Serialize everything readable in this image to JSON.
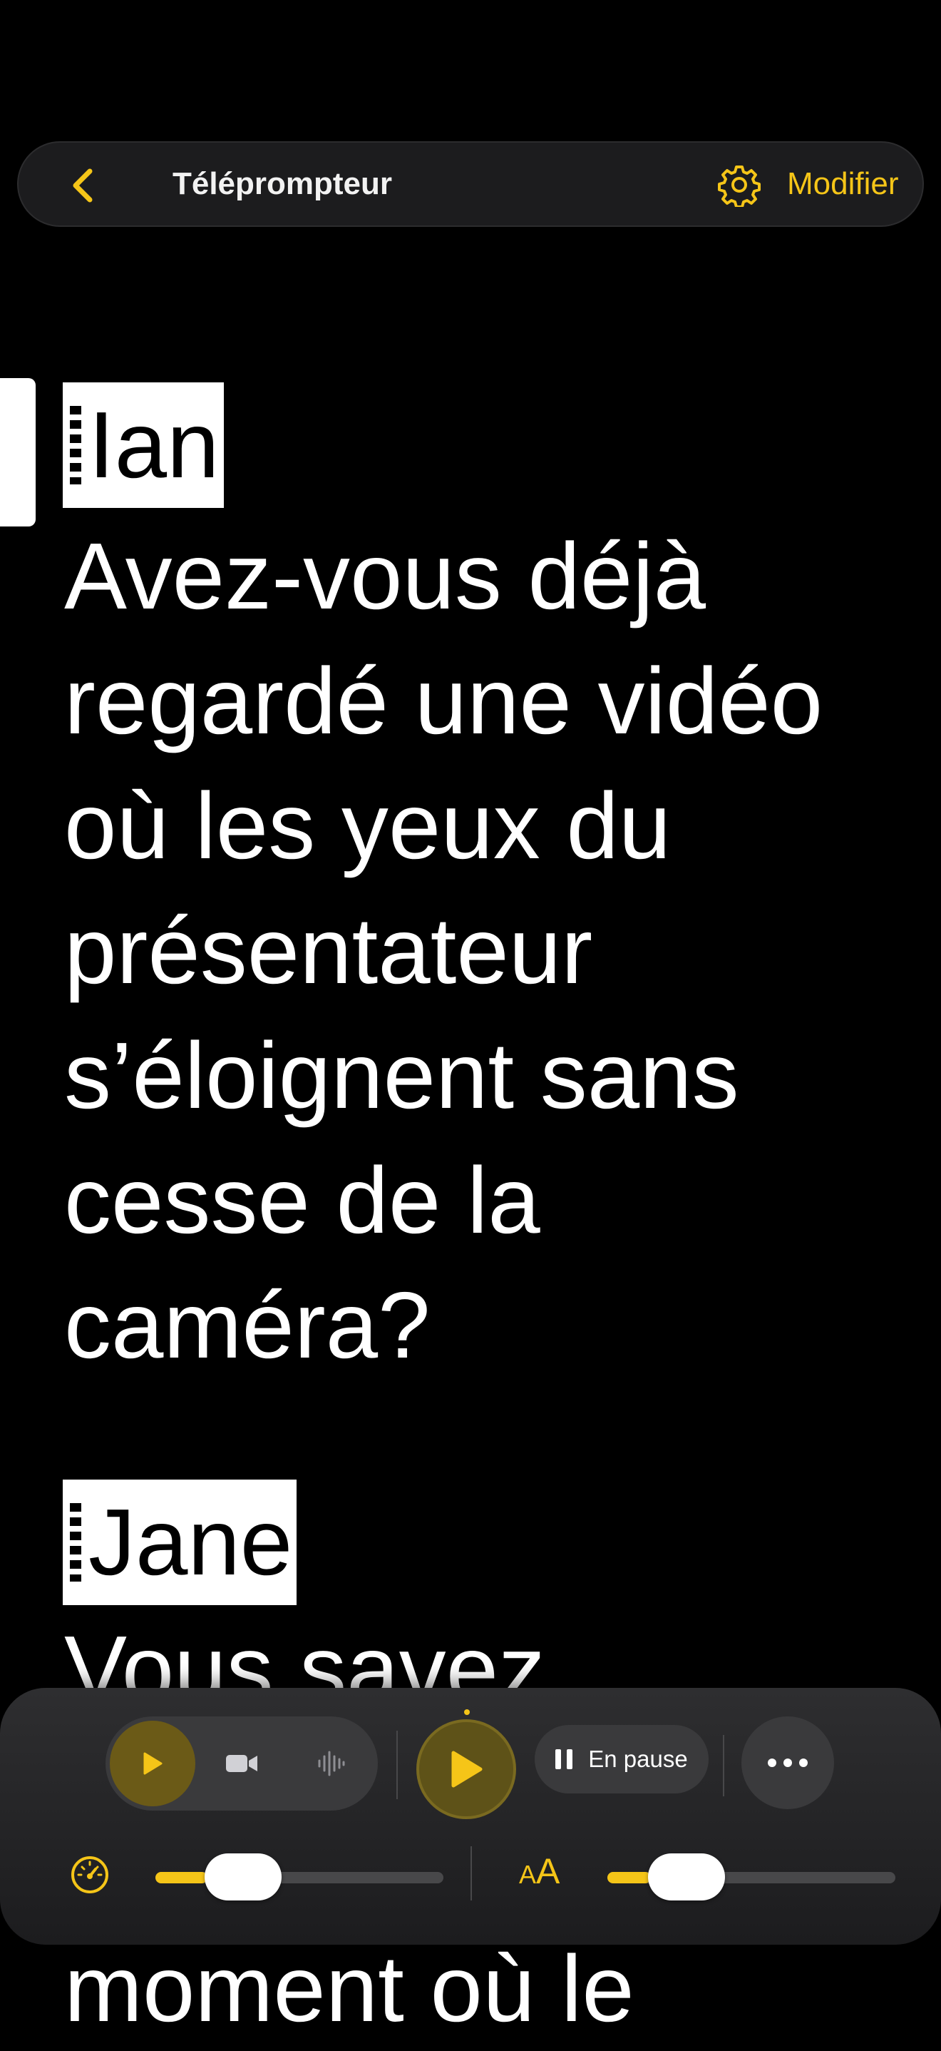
{
  "nav": {
    "back_icon": "chevron-left-icon",
    "title": "Téléprompteur",
    "settings_icon": "gear-icon",
    "edit_label": "Modifier"
  },
  "script": [
    {
      "speaker": "Ian",
      "lines": [
        "Avez-vous déjà",
        "regardé une vidéo",
        "où les yeux du",
        "présentateur",
        "s’éloignent sans",
        "cesse de la",
        "caméra?"
      ]
    },
    {
      "speaker": "Jane",
      "lines": [
        "Vous savez"
      ]
    }
  ],
  "below_panel_text": "moment où le",
  "controls": {
    "modes": [
      {
        "icon": "play-icon",
        "active": true
      },
      {
        "icon": "video-camera-icon",
        "active": false
      },
      {
        "icon": "waveform-icon",
        "active": false
      }
    ],
    "play_icon": "play-icon",
    "status_label": "En pause",
    "more_icon": "ellipsis-icon",
    "speed_icon": "speedometer-icon",
    "speed_level": 0.18,
    "font_size_icon": "text-size-icon",
    "font_size_label_small": "A",
    "font_size_label_large": "A",
    "font_size_level": 0.15,
    "accent_color": "#f5c518"
  }
}
